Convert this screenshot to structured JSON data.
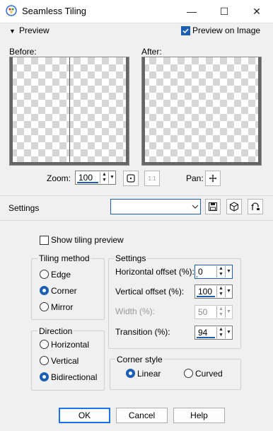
{
  "window": {
    "title": "Seamless Tiling",
    "minimize_glyph": "—",
    "maximize_glyph": "☐",
    "close_glyph": "✕",
    "app_icon": "paintshop-logo-icon"
  },
  "preview_section": {
    "label": "Preview",
    "preview_on_image_label": "Preview on Image",
    "preview_on_image_checked": true,
    "before_label": "Before:",
    "after_label": "After:"
  },
  "zoom": {
    "label": "Zoom:",
    "value": "100",
    "pan_label": "Pan:",
    "actual_size_glyph": "1:1"
  },
  "settings_bar": {
    "label": "Settings",
    "preset_value": ""
  },
  "show_tiling_preview": {
    "label": "Show tiling preview",
    "checked": false
  },
  "tiling_method": {
    "title": "Tiling method",
    "options": [
      "Edge",
      "Corner",
      "Mirror"
    ],
    "selected": "Corner"
  },
  "direction": {
    "title": "Direction",
    "options": [
      "Horizontal",
      "Vertical",
      "Bidirectional"
    ],
    "selected": "Bidirectional"
  },
  "settings_group": {
    "title": "Settings",
    "horizontal_offset_label": "Horizontal offset (%):",
    "horizontal_offset_value": "0",
    "vertical_offset_label": "Vertical offset (%):",
    "vertical_offset_value": "100",
    "width_label": "Width (%):",
    "width_value": "50",
    "transition_label": "Transition (%):",
    "transition_value": "94"
  },
  "corner_style": {
    "title": "Corner style",
    "options": [
      "Linear",
      "Curved"
    ],
    "selected": "Linear"
  },
  "buttons": {
    "ok": "OK",
    "cancel": "Cancel",
    "help": "Help"
  },
  "colors": {
    "accent": "#1a5fb4",
    "default_button_border": "#1a73e8"
  }
}
